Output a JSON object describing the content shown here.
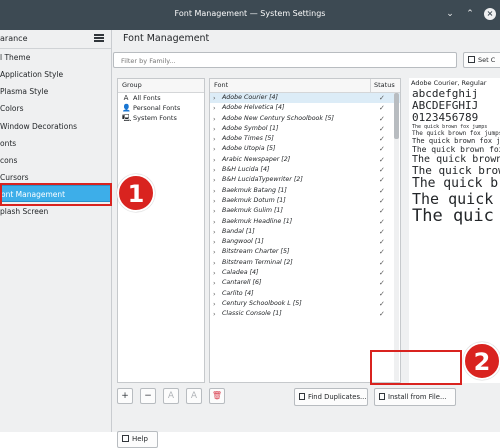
{
  "window": {
    "title": "Font Management — System Settings"
  },
  "sidebar": {
    "header": "arance",
    "items": [
      {
        "label": "l Theme"
      },
      {
        "label": "Application Style"
      },
      {
        "label": "Plasma Style"
      },
      {
        "label": "Colors"
      },
      {
        "label": "Window Decorations"
      },
      {
        "label": "onts"
      },
      {
        "label": "cons"
      },
      {
        "label": "Cursors"
      },
      {
        "label": "ont Management"
      },
      {
        "label": "plash Screen"
      }
    ]
  },
  "page": {
    "title": "Font Management",
    "filter_placeholder": "Filter by Family...",
    "set_button_label": "Set C"
  },
  "groups": {
    "header": "Group",
    "items": [
      {
        "icon": "A",
        "label": "All Fonts"
      },
      {
        "icon": "👤",
        "label": "Personal Fonts"
      },
      {
        "icon": "🖳",
        "label": "System Fonts"
      }
    ]
  },
  "fonts": {
    "header_font": "Font",
    "header_status": "Status",
    "check": "✓",
    "chevron": "›",
    "rows": [
      {
        "name": "Adobe Courier [4]"
      },
      {
        "name": "Adobe Helvetica [4]"
      },
      {
        "name": "Adobe New Century Schoolbook [5]"
      },
      {
        "name": "Adobe Symbol [1]"
      },
      {
        "name": "Adobe Times [5]"
      },
      {
        "name": "Adobe Utopia [5]"
      },
      {
        "name": "Arabic Newspaper [2]"
      },
      {
        "name": "B&H Lucida [4]"
      },
      {
        "name": "B&H LucidaTypewriter [2]"
      },
      {
        "name": "Baekmuk Batang [1]"
      },
      {
        "name": "Baekmuk Dotum [1]"
      },
      {
        "name": "Baekmuk Gulim [1]"
      },
      {
        "name": "Baekmuk Headline [1]"
      },
      {
        "name": "Bandal [1]"
      },
      {
        "name": "Bangwool [1]"
      },
      {
        "name": "Bitstream Charter [5]"
      },
      {
        "name": "Bitstream Terminal [2]"
      },
      {
        "name": "Caladea [4]"
      },
      {
        "name": "Cantarell [6]"
      },
      {
        "name": "Carlito [4]"
      },
      {
        "name": "Century Schoolbook L [5]"
      },
      {
        "name": "Classic Console [1]"
      }
    ]
  },
  "preview": {
    "title": "Adobe Courier, Regular",
    "lines": [
      {
        "text": "abcdefghij"
      },
      {
        "text": "ABCDEFGHIJ"
      },
      {
        "text": "0123456789"
      },
      {
        "text": "The quick brown fox jumps"
      },
      {
        "text": "The quick brown fox jumps"
      },
      {
        "text": "The quick brown fox jumps"
      },
      {
        "text": "The quick brown fox jumps"
      },
      {
        "text": "The quick brown fox"
      },
      {
        "text": "The quick brown"
      },
      {
        "text": "The quick bro"
      },
      {
        "text": "The quick"
      },
      {
        "text": "The quic"
      }
    ]
  },
  "toolbar": {
    "add": "+",
    "remove": "−",
    "enable": "A",
    "disable": "A",
    "delete": "🗑",
    "find_duplicates_label": "Find Duplicates...",
    "install_label": "Install from File..."
  },
  "help": {
    "label": "Help"
  },
  "callouts": {
    "one": "1",
    "two": "2"
  }
}
